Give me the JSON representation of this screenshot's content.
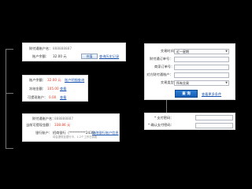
{
  "card1": {
    "label1": "财付通账户名：",
    "value1": "888888887",
    "label2": "账户余额：",
    "value2": "32.00 元",
    "button": "充值",
    "link": "查询历史记录"
  },
  "card2": {
    "label1": "账户余额：",
    "value1": "32.00 元",
    "link1": "账户明细查询",
    "label2": "冻结金额：",
    "value2": "105.00",
    "link2": "查看",
    "label3": "可提现账户：",
    "value3": "0.00",
    "link3": "查看"
  },
  "card3": {
    "label1": "财付通账户名：",
    "value1": "888888887",
    "label2": "当前可提现金额：",
    "value2": "338.86 元",
    "label3": "银行账户：",
    "value3": "招商银行（**********2435）",
    "link3": "修改银行账户信息",
    "note": "将会提现至银行卡，1-2个工作日到账"
  },
  "search": {
    "label1": "交易时间：",
    "select1": "近一星期",
    "label2": "财付通订单号：",
    "label3": "商家订单号：",
    "label4": "对方财付通账户：",
    "label5": "交易类型：",
    "select5": "所有交易",
    "button": "查 询",
    "link": "查看更多条件"
  },
  "password": {
    "label1": "* 支付密码：",
    "label2": "* 确认支付密码："
  }
}
